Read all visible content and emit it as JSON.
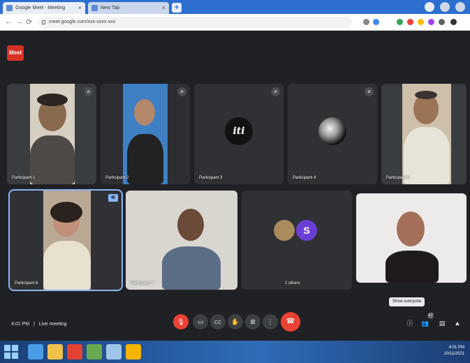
{
  "browser": {
    "tabs": [
      {
        "title": "Google Meet - Meeting",
        "active": true
      },
      {
        "title": "New Tab",
        "active": false
      }
    ],
    "new_tab_label": "+",
    "address": "meet.google.com/xxx-xxxx-xxx",
    "nav": {
      "back": "←",
      "forward": "→",
      "reload": "⟳"
    }
  },
  "meet": {
    "logo_text": "Meet",
    "participants_row1": [
      {
        "name": "Participant 1",
        "type": "video"
      },
      {
        "name": "Participant 2",
        "type": "video"
      },
      {
        "name": "Participant 3",
        "type": "avatar",
        "avatar_text": "iti"
      },
      {
        "name": "Participant 4",
        "type": "avatar"
      },
      {
        "name": "Participant 5",
        "type": "video"
      }
    ],
    "participants_row2": [
      {
        "name": "Participant 6",
        "type": "video",
        "pinned": true
      },
      {
        "name": "Participant 7",
        "type": "video"
      },
      {
        "name": "2 others",
        "type": "group",
        "avatar_letter": "S"
      },
      {
        "name": "",
        "type": "video"
      }
    ],
    "meeting_time": "4:01 PM",
    "meeting_code": "Live meeting",
    "tooltip": "Show everyone",
    "participant_count": "17",
    "controls": {
      "mic": "mic-off",
      "camera": "camera",
      "captions": "CC",
      "raise_hand": "hand",
      "present": "present",
      "more": "⋮",
      "end_call": "end"
    }
  },
  "taskbar": {
    "clock_time": "4:01 PM",
    "clock_date": "10/11/2021"
  },
  "colors": {
    "stage": "#202124",
    "tile": "#3c4043",
    "end_call": "#ea4335",
    "accent": "#8ab4f8",
    "tabbar": "#2c6fd1"
  }
}
